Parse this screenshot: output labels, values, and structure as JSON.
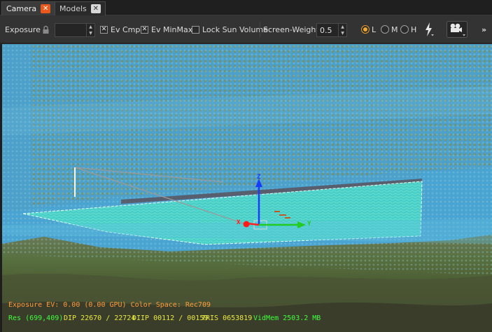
{
  "tabs": [
    {
      "label": "Camera",
      "active": true
    },
    {
      "label": "Models",
      "active": false
    }
  ],
  "toolbar": {
    "exposure_label": "Exposure",
    "exposure_value": "",
    "ev_cmp_label": "Ev Cmp",
    "ev_cmp_checked": true,
    "ev_minmax_label": "Ev MinMax",
    "ev_minmax_checked": true,
    "lock_sun_label": "Lock Sun Volume",
    "lock_sun_checked": false,
    "screen_weight_label": "Screen-Weight",
    "screen_weight_value": "0.5",
    "lod_options": [
      {
        "label": "L",
        "selected": true
      },
      {
        "label": "M",
        "selected": false
      },
      {
        "label": "H",
        "selected": false
      }
    ],
    "camera_3d_label": "3D",
    "overflow_label": "»"
  },
  "viewport": {
    "gizmo_axes": {
      "x": "X",
      "y": "Y",
      "z": "Z"
    },
    "stats": {
      "exposure_line": "Exposure EV: 0.00 (0.00 GPU)  Color Space: Rec709",
      "res": "Res (699,409)",
      "dip": "DIP 22670 / 22724",
      "diip": "DIIP 00112 / 00159",
      "tris": "TRIS 0653819",
      "vidmem": "VidMem 2503.2 MB"
    }
  },
  "colors": {
    "accent_orange": "#e9581d",
    "radio_selected": "#f0a830",
    "stats_orange": "#ff9a3a",
    "stats_green": "#3cff3c",
    "stats_yellow": "#e8e840",
    "volume_cyan": "#49d6c6"
  },
  "icons": {
    "lock": "lock-icon",
    "lightning": "lightning-icon",
    "camera3d": "camera-3d-icon"
  }
}
